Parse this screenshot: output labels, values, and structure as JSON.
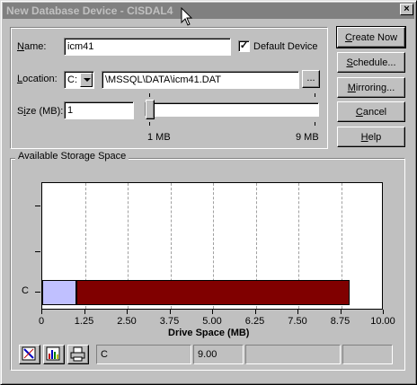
{
  "window": {
    "title": "New Database Device - CISDAL4",
    "close_label": "×"
  },
  "form": {
    "name_label_prefix": "",
    "name_label_u": "N",
    "name_label_rest": "ame:",
    "name_value": "icm41",
    "default_device_label": "Default Device",
    "default_device_checked": "✓",
    "location_label_pre": "",
    "location_label_u": "L",
    "location_label_rest": "ocation:",
    "drive_value": "C:",
    "path_value": "\\MSSQL\\DATA\\icm41.DAT",
    "browse_label": "...",
    "size_label_pre": "S",
    "size_label_u": "i",
    "size_label_rest": "ze (MB):",
    "size_value": "1",
    "slider_min_label": "1 MB",
    "slider_max_label": "9 MB"
  },
  "buttons": {
    "create_now": "Create Now",
    "schedule": "Schedule...",
    "mirroring": "Mirroring...",
    "cancel": "Cancel",
    "help": "Help"
  },
  "storage": {
    "group_title": "Available Storage Space"
  },
  "chart_data": {
    "type": "bar",
    "orientation": "horizontal",
    "categories": [
      "C"
    ],
    "series": [
      {
        "values": [
          1.0
        ],
        "color": "#c0c0ff"
      },
      {
        "values": [
          8.0
        ],
        "color": "#800000"
      }
    ],
    "xlabel": "Drive Space (MB)",
    "xlim": [
      0,
      10
    ],
    "xticks": [
      "0",
      "1.25",
      "2.50",
      "3.75",
      "5.00",
      "6.25",
      "7.50",
      "8.75",
      "10.00"
    ],
    "grid": true
  },
  "statusbar": {
    "drive": "C",
    "size": "9.00"
  },
  "colors": {
    "new_device": "#c0c0ff",
    "used": "#800000"
  }
}
